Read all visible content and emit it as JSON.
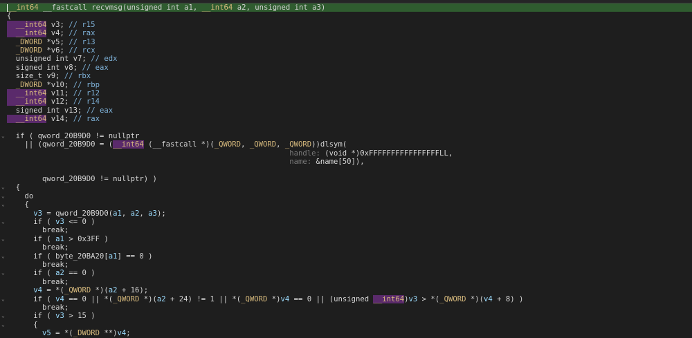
{
  "lines": [
    {
      "hl": true,
      "seg": [
        {
          "c": "ty",
          "t": "__int64"
        },
        {
          "c": "t",
          "t": " __fastcall recvmsg(unsigned int a1, "
        },
        {
          "c": "ty",
          "t": "__int64"
        },
        {
          "c": "t",
          "t": " a2, unsigned int a3)"
        }
      ]
    },
    {
      "seg": [
        {
          "c": "t",
          "t": "{"
        }
      ]
    },
    {
      "seg": [
        {
          "c": "ty64",
          "t": "  __int64"
        },
        {
          "c": "t",
          "t": " v3; "
        },
        {
          "c": "cm",
          "t": "// r15"
        }
      ]
    },
    {
      "seg": [
        {
          "c": "ty64",
          "t": "  __int64"
        },
        {
          "c": "t",
          "t": " v4; "
        },
        {
          "c": "cm",
          "t": "// rax"
        }
      ]
    },
    {
      "seg": [
        {
          "c": "ty",
          "t": "  _DWORD"
        },
        {
          "c": "t",
          "t": " *v5; "
        },
        {
          "c": "cm",
          "t": "// r13"
        }
      ]
    },
    {
      "seg": [
        {
          "c": "ty",
          "t": "  _DWORD"
        },
        {
          "c": "t",
          "t": " *v6; "
        },
        {
          "c": "cm",
          "t": "// rcx"
        }
      ]
    },
    {
      "seg": [
        {
          "c": "t",
          "t": "  unsigned int v7; "
        },
        {
          "c": "cm",
          "t": "// edx"
        }
      ]
    },
    {
      "seg": [
        {
          "c": "t",
          "t": "  signed int v8; "
        },
        {
          "c": "cm",
          "t": "// eax"
        }
      ]
    },
    {
      "seg": [
        {
          "c": "t",
          "t": "  size_t v9; "
        },
        {
          "c": "cm",
          "t": "// rbx"
        }
      ]
    },
    {
      "seg": [
        {
          "c": "ty",
          "t": "  _DWORD"
        },
        {
          "c": "t",
          "t": " *v10; "
        },
        {
          "c": "cm",
          "t": "// rbp"
        }
      ]
    },
    {
      "seg": [
        {
          "c": "ty64",
          "t": "  __int64"
        },
        {
          "c": "t",
          "t": " v11; "
        },
        {
          "c": "cm",
          "t": "// r12"
        }
      ]
    },
    {
      "seg": [
        {
          "c": "ty64",
          "t": "  __int64"
        },
        {
          "c": "t",
          "t": " v12; "
        },
        {
          "c": "cm",
          "t": "// r14"
        }
      ]
    },
    {
      "seg": [
        {
          "c": "t",
          "t": "  signed int v13; "
        },
        {
          "c": "cm",
          "t": "// eax"
        }
      ]
    },
    {
      "seg": [
        {
          "c": "ty64",
          "t": "  __int64"
        },
        {
          "c": "t",
          "t": " v14; "
        },
        {
          "c": "cm",
          "t": "// rax"
        }
      ]
    },
    {
      "seg": [
        {
          "c": "t",
          "t": ""
        }
      ]
    },
    {
      "fold": true,
      "seg": [
        {
          "c": "t",
          "t": "  if ( qword_20B9D0 != nullptr"
        }
      ]
    },
    {
      "seg": [
        {
          "c": "t",
          "t": "    || (qword_20B9D0 = ("
        },
        {
          "c": "ty64",
          "t": "__int64"
        },
        {
          "c": "t",
          "t": " (__fastcall *)("
        },
        {
          "c": "ty",
          "t": "_QWORD"
        },
        {
          "c": "t",
          "t": ", "
        },
        {
          "c": "ty",
          "t": "_QWORD"
        },
        {
          "c": "t",
          "t": ", "
        },
        {
          "c": "ty",
          "t": "_QWORD"
        },
        {
          "c": "t",
          "t": "))dlsym("
        }
      ]
    },
    {
      "seg": [
        {
          "c": "t",
          "t": "                                                                "
        },
        {
          "c": "hint",
          "t": "handle: "
        },
        {
          "c": "t",
          "t": "(void *)0xFFFFFFFFFFFFFFFFLL,"
        }
      ]
    },
    {
      "seg": [
        {
          "c": "t",
          "t": "                                                                "
        },
        {
          "c": "hint",
          "t": "name: "
        },
        {
          "c": "t",
          "t": "&name[50]),"
        }
      ]
    },
    {
      "seg": [
        {
          "c": "t",
          "t": ""
        }
      ]
    },
    {
      "seg": [
        {
          "c": "t",
          "t": "        qword_20B9D0 != nullptr) )"
        }
      ]
    },
    {
      "fold": true,
      "seg": [
        {
          "c": "t",
          "t": "  {"
        }
      ]
    },
    {
      "fold": true,
      "seg": [
        {
          "c": "t",
          "t": "    do"
        }
      ]
    },
    {
      "fold": true,
      "seg": [
        {
          "c": "t",
          "t": "    {"
        }
      ]
    },
    {
      "seg": [
        {
          "c": "t",
          "t": "      "
        },
        {
          "c": "va",
          "t": "v3"
        },
        {
          "c": "t",
          "t": " = qword_20B9D0("
        },
        {
          "c": "va",
          "t": "a1"
        },
        {
          "c": "t",
          "t": ", "
        },
        {
          "c": "va",
          "t": "a2"
        },
        {
          "c": "t",
          "t": ", "
        },
        {
          "c": "va",
          "t": "a3"
        },
        {
          "c": "t",
          "t": ");"
        }
      ]
    },
    {
      "fold": true,
      "seg": [
        {
          "c": "t",
          "t": "      if ( "
        },
        {
          "c": "va",
          "t": "v3"
        },
        {
          "c": "t",
          "t": " <= 0 )"
        }
      ]
    },
    {
      "seg": [
        {
          "c": "t",
          "t": "        break;"
        }
      ]
    },
    {
      "fold": true,
      "seg": [
        {
          "c": "t",
          "t": "      if ( "
        },
        {
          "c": "va",
          "t": "a1"
        },
        {
          "c": "t",
          "t": " > 0x3FF )"
        }
      ]
    },
    {
      "seg": [
        {
          "c": "t",
          "t": "        break;"
        }
      ]
    },
    {
      "fold": true,
      "seg": [
        {
          "c": "t",
          "t": "      if ( byte_20BA20["
        },
        {
          "c": "va",
          "t": "a1"
        },
        {
          "c": "t",
          "t": "] == 0 )"
        }
      ]
    },
    {
      "seg": [
        {
          "c": "t",
          "t": "        break;"
        }
      ]
    },
    {
      "fold": true,
      "seg": [
        {
          "c": "t",
          "t": "      if ( "
        },
        {
          "c": "va",
          "t": "a2"
        },
        {
          "c": "t",
          "t": " == 0 )"
        }
      ]
    },
    {
      "seg": [
        {
          "c": "t",
          "t": "        break;"
        }
      ]
    },
    {
      "seg": [
        {
          "c": "t",
          "t": "      "
        },
        {
          "c": "va",
          "t": "v4"
        },
        {
          "c": "t",
          "t": " = *("
        },
        {
          "c": "ty",
          "t": "_QWORD"
        },
        {
          "c": "t",
          "t": " *)("
        },
        {
          "c": "va",
          "t": "a2"
        },
        {
          "c": "t",
          "t": " + 16);"
        }
      ]
    },
    {
      "fold": true,
      "seg": [
        {
          "c": "t",
          "t": "      if ( "
        },
        {
          "c": "va",
          "t": "v4"
        },
        {
          "c": "t",
          "t": " == 0 || *("
        },
        {
          "c": "ty",
          "t": "_QWORD"
        },
        {
          "c": "t",
          "t": " *)("
        },
        {
          "c": "va",
          "t": "a2"
        },
        {
          "c": "t",
          "t": " + 24) != 1 || *("
        },
        {
          "c": "ty",
          "t": "_QWORD"
        },
        {
          "c": "t",
          "t": " *)"
        },
        {
          "c": "va",
          "t": "v4"
        },
        {
          "c": "t",
          "t": " == 0 || (unsigned "
        },
        {
          "c": "ty64",
          "t": "__int64"
        },
        {
          "c": "t",
          "t": ")"
        },
        {
          "c": "va",
          "t": "v3"
        },
        {
          "c": "t",
          "t": " > *("
        },
        {
          "c": "ty",
          "t": "_QWORD"
        },
        {
          "c": "t",
          "t": " *)("
        },
        {
          "c": "va",
          "t": "v4"
        },
        {
          "c": "t",
          "t": " + 8) )"
        }
      ]
    },
    {
      "seg": [
        {
          "c": "t",
          "t": "        break;"
        }
      ]
    },
    {
      "fold": true,
      "seg": [
        {
          "c": "t",
          "t": "      if ( "
        },
        {
          "c": "va",
          "t": "v3"
        },
        {
          "c": "t",
          "t": " > 15 )"
        }
      ]
    },
    {
      "fold": true,
      "seg": [
        {
          "c": "t",
          "t": "      {"
        }
      ]
    },
    {
      "seg": [
        {
          "c": "t",
          "t": "        "
        },
        {
          "c": "va",
          "t": "v5"
        },
        {
          "c": "t",
          "t": " = *("
        },
        {
          "c": "ty",
          "t": "_DWORD"
        },
        {
          "c": "t",
          "t": " **)"
        },
        {
          "c": "va",
          "t": "v4"
        },
        {
          "c": "t",
          "t": ";"
        }
      ]
    }
  ]
}
